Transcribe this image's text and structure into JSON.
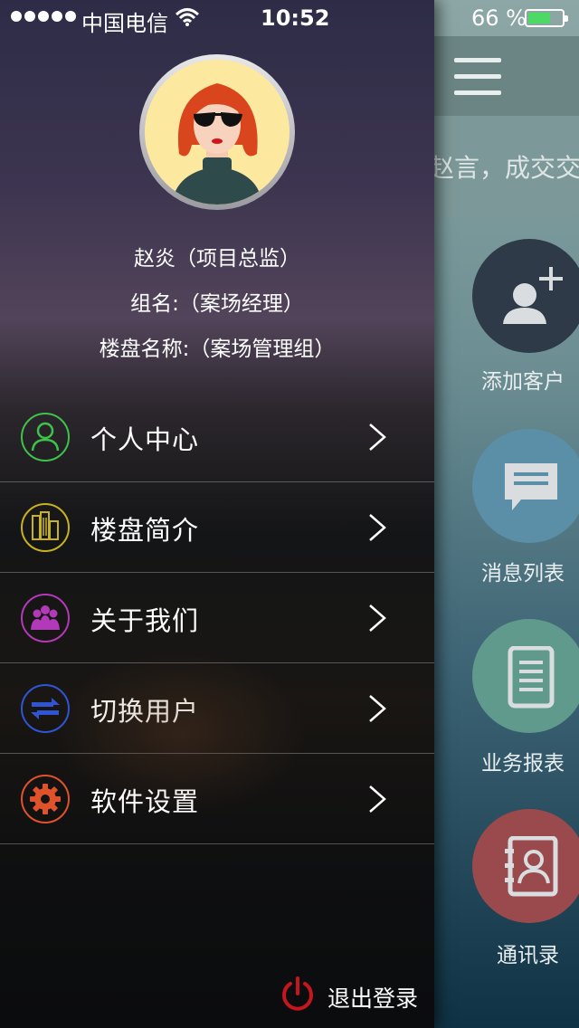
{
  "status_bar": {
    "carrier": "中国电信",
    "time": "10:52",
    "battery_percent": "66 %",
    "battery_level": 0.66
  },
  "main_page": {
    "ticker_text": "赵言，成交交",
    "tiles": [
      {
        "label": "添加客户",
        "icon": "add-user-icon",
        "color": "#2e3a48"
      },
      {
        "label": "消息列表",
        "icon": "message-icon",
        "color": "#5b8fa8"
      },
      {
        "label": "业务报表",
        "icon": "report-icon",
        "color": "#5f9a8c"
      },
      {
        "label": "通讯录",
        "icon": "contacts-icon",
        "color": "#9a4a4c"
      }
    ]
  },
  "drawer": {
    "profile": {
      "name_role": "赵炎（项目总监）",
      "group": "组名:（案场经理）",
      "project": "楼盘名称:（案场管理组）"
    },
    "menu": [
      {
        "label": "个人中心",
        "icon": "person-icon",
        "color": "#3ec34a"
      },
      {
        "label": "楼盘简介",
        "icon": "buildings-icon",
        "color": "#c9b21f"
      },
      {
        "label": "关于我们",
        "icon": "team-icon",
        "color": "#b23ab8"
      },
      {
        "label": "切换用户",
        "icon": "switch-arrows-icon",
        "color": "#2f55d6"
      },
      {
        "label": "软件设置",
        "icon": "gear-icon",
        "color": "#e0522a"
      }
    ],
    "logout": {
      "label": "退出登录",
      "icon": "power-icon",
      "color": "#c4161c"
    }
  }
}
